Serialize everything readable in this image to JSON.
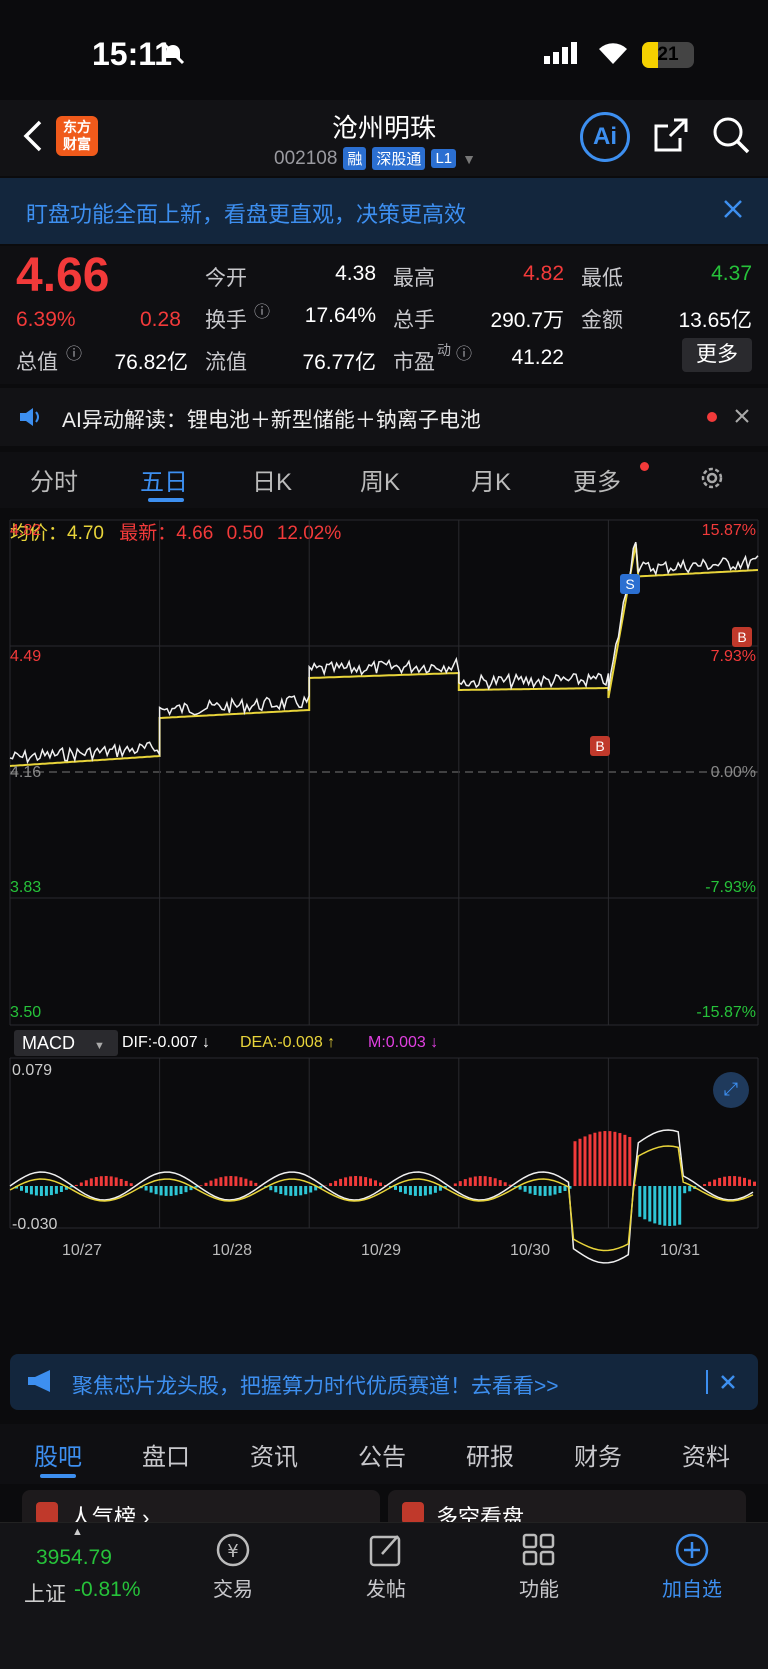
{
  "status": {
    "time": "15:11",
    "battery": "21"
  },
  "header": {
    "title": "沧州明珠",
    "code": "002108",
    "tags": [
      "融",
      "深股通",
      "L1"
    ],
    "logo": "东方\n财富"
  },
  "banner": {
    "text": "盯盘功能全面上新，看盘更直观，决策更高效"
  },
  "quote": {
    "price": "4.66",
    "pct": "6.39%",
    "change": "0.28",
    "open_label": "今开",
    "open": "4.38",
    "high_label": "最高",
    "high": "4.82",
    "low_label": "最低",
    "low": "4.37",
    "turnover_label": "换手",
    "turnover": "17.64%",
    "volume_label": "总手",
    "volume": "290.7万",
    "amount_label": "金额",
    "amount": "13.65亿",
    "mktcap_label": "总值",
    "mktcap": "76.82亿",
    "float_label": "流值",
    "float": "76.77亿",
    "pe_label": "市盈",
    "pe_sup": "动",
    "pe": "41.22",
    "more": "更多"
  },
  "ai": {
    "text": "AI异动解读：锂电池＋新型储能＋钠离子电池"
  },
  "tabs": [
    "分时",
    "五日",
    "日K",
    "周K",
    "月K",
    "更多"
  ],
  "chart": {
    "avg_label": "均价：",
    "avg": "4.70",
    "latest_label": "最新：",
    "latest": "4.66",
    "latest_chg": "0.50",
    "latest_pct": "12.02%",
    "y_left": [
      "4.82",
      "4.49",
      "4.16",
      "3.83",
      "3.50"
    ],
    "y_right": [
      "15.87%",
      "7.93%",
      "0.00%",
      "-7.93%",
      "-15.87%"
    ],
    "macd_label": "MACD",
    "dif": "DIF:-0.007 ↓",
    "dea": "DEA:-0.008 ↑",
    "m": "M:0.003 ↓",
    "macd_top": "0.079",
    "macd_bottom": "-0.030",
    "dates": [
      "10/27",
      "10/28",
      "10/29",
      "10/30",
      "10/31"
    ],
    "markers": {
      "b": "B",
      "s": "S"
    }
  },
  "chart_data": {
    "type": "line",
    "x": [
      "10/27",
      "10/28",
      "10/29",
      "10/30",
      "10/31"
    ],
    "series": [],
    "ylim": [
      3.5,
      4.82
    ],
    "base": 4.16
  },
  "ad": {
    "text": "聚焦芯片龙头股，把握算力时代优质赛道！去看看>>"
  },
  "bottom_tabs": [
    "股吧",
    "盘口",
    "资讯",
    "公告",
    "研报",
    "财务",
    "资料"
  ],
  "cards": [
    "人气榜 ›",
    "多空看盘"
  ],
  "footer": {
    "index_value": "3954.79",
    "index_name": "上证",
    "index_pct": "-0.81%",
    "items": [
      "交易",
      "发帖",
      "功能",
      "加自选"
    ]
  },
  "colors": {
    "up": "#f23a3a",
    "down": "#26c23a",
    "accent": "#3d8ff0",
    "avg": "#e8d43a"
  }
}
